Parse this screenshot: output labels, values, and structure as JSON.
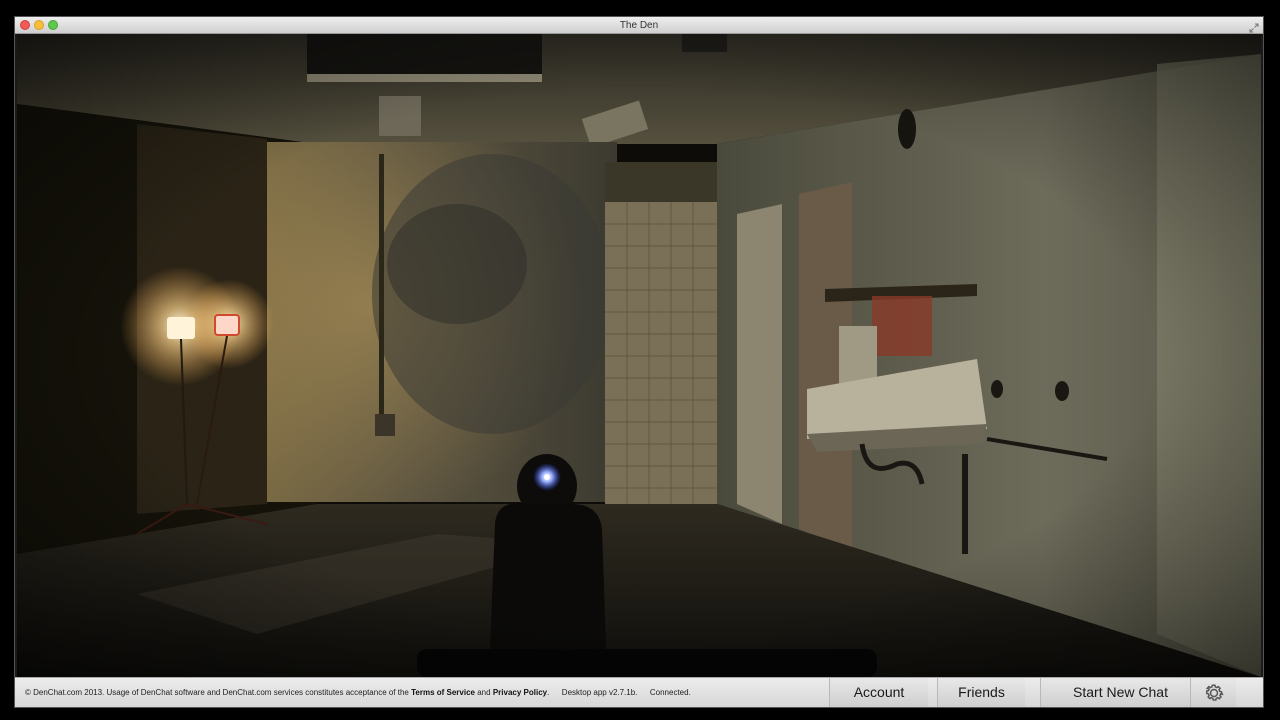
{
  "window": {
    "title": "The Den"
  },
  "icons": {
    "close": "close-dot-icon",
    "minimize": "minimize-dot-icon",
    "zoom": "zoom-dot-icon",
    "fullscreen": "fullscreen-arrows-icon",
    "settings": "gear-icon"
  },
  "footer": {
    "copyright": "© DenChat.com 2013. Usage of DenChat software and DenChat.com services constitutes acceptance of the",
    "terms_label": "Terms of Service",
    "and_label": "and",
    "privacy_label": "Privacy Policy",
    "period": ".",
    "version": "Desktop app v2.7.1b.",
    "status": "Connected.",
    "account_label": "Account",
    "friends_label": "Friends",
    "new_chat_label": "Start New Chat"
  },
  "colors": {
    "titlebar": "#dcdcdc",
    "footer": "#e0e0e0",
    "close": "#f25a55",
    "minimize": "#f6be3b",
    "zoom": "#5fc74e"
  }
}
